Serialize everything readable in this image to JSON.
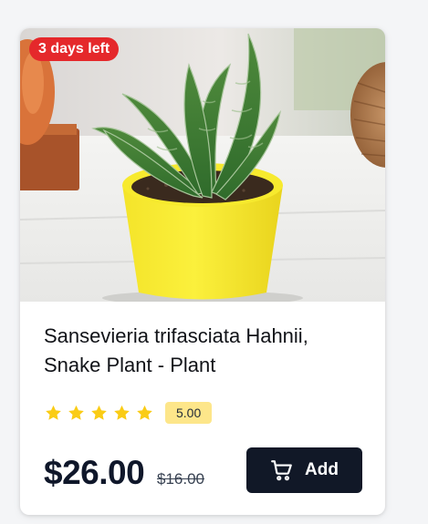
{
  "product": {
    "badge": "3 days left",
    "image_alt": "Snake plant in a yellow pot",
    "title": "Sansevieria trifasciata Hahnii, Snake Plant - Plant",
    "rating": {
      "stars": 5,
      "max": 5,
      "value_label": "5.00",
      "star_color": "#facc15"
    },
    "price": "$26.00",
    "old_price": "$16.00",
    "add_label": "Add",
    "add_icon": "cart-icon"
  },
  "colors": {
    "badge": "#e5282b",
    "button": "#111827",
    "rating_pill": "#fde68a"
  }
}
